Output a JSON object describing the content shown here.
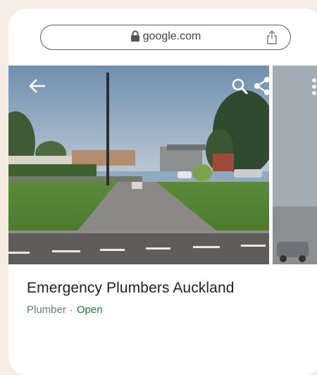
{
  "browser": {
    "url": "google.com",
    "lock_icon": "lock-icon",
    "share_icon": "share-icon"
  },
  "photo_viewer": {
    "back_icon": "arrow-back-icon",
    "search_icon": "search-icon",
    "share_icon": "share-icon",
    "more_icon": "more-vert-icon"
  },
  "place": {
    "name": "Emergency Plumbers Auckland",
    "category": "Plumber",
    "separator": "·",
    "status": "Open",
    "status_color": "#188038"
  }
}
